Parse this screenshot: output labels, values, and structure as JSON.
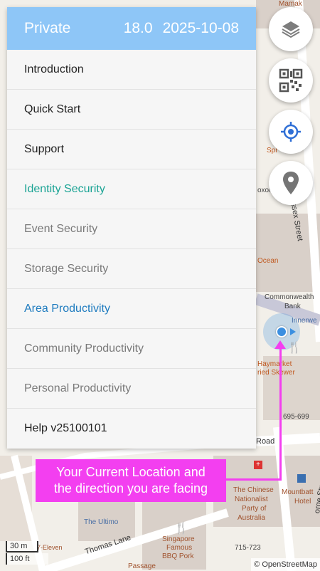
{
  "header": {
    "title": "Private",
    "version": "18.0",
    "date": "2025-10-08"
  },
  "menu": [
    {
      "label": "Introduction",
      "style": "normal"
    },
    {
      "label": "Quick Start",
      "style": "normal"
    },
    {
      "label": "Support",
      "style": "normal"
    },
    {
      "label": "Identity Security",
      "style": "teal"
    },
    {
      "label": "Event Security",
      "style": "gray"
    },
    {
      "label": "Storage Security",
      "style": "gray"
    },
    {
      "label": "Area Productivity",
      "style": "blue"
    },
    {
      "label": "Community Productivity",
      "style": "gray"
    },
    {
      "label": "Personal Productivity",
      "style": "gray"
    },
    {
      "label": "Help v25100101",
      "style": "normal"
    }
  ],
  "buttons": {
    "layers": "layers-icon",
    "qr": "qr-code-icon",
    "locate": "crosshair-location-icon",
    "pin": "map-pin-icon"
  },
  "tooltip": {
    "line1": "Your Current Location and",
    "line2": "the direction you are facing"
  },
  "map": {
    "labels": {
      "mamak": "Mamak",
      "sussex": "Sussex Street",
      "george": "orge Street",
      "ocean": "Ocean",
      "commonwealth": "Commonwealth",
      "bank": "Bank",
      "innerwest": "Innerwe",
      "haymarket": "Haymarket",
      "skewer": "ried Skewer",
      "num695": "695-699",
      "road": "Road",
      "chinese1": "The Chinese",
      "chinese2": "Nationalist",
      "chinese3": "Party of",
      "chinese4": "Australia",
      "mountbatten": "Mountbatt",
      "hotel": "Hotel",
      "ultimo": "The Ultimo",
      "eleven": "7-Eleven",
      "thomas": "Thomas Lane",
      "singapore1": "Singapore",
      "singapore2": "Famous",
      "singapore3": "BBQ Pork",
      "passage": "Passage",
      "num715": "715-723",
      "oxon": "oxon",
      "spr": "Spr",
      "ay": "ay Street",
      "arl": "arl",
      "ys": "ys"
    },
    "colors": {
      "background": "#f2efe9",
      "building": "#d9d0c9",
      "road": "#ffffff",
      "location": "#3b8fe0",
      "accent": "#f33ff0"
    }
  },
  "scale": {
    "metric": "30 m",
    "imperial": "100 ft"
  },
  "attribution": "© OpenStreetMap"
}
